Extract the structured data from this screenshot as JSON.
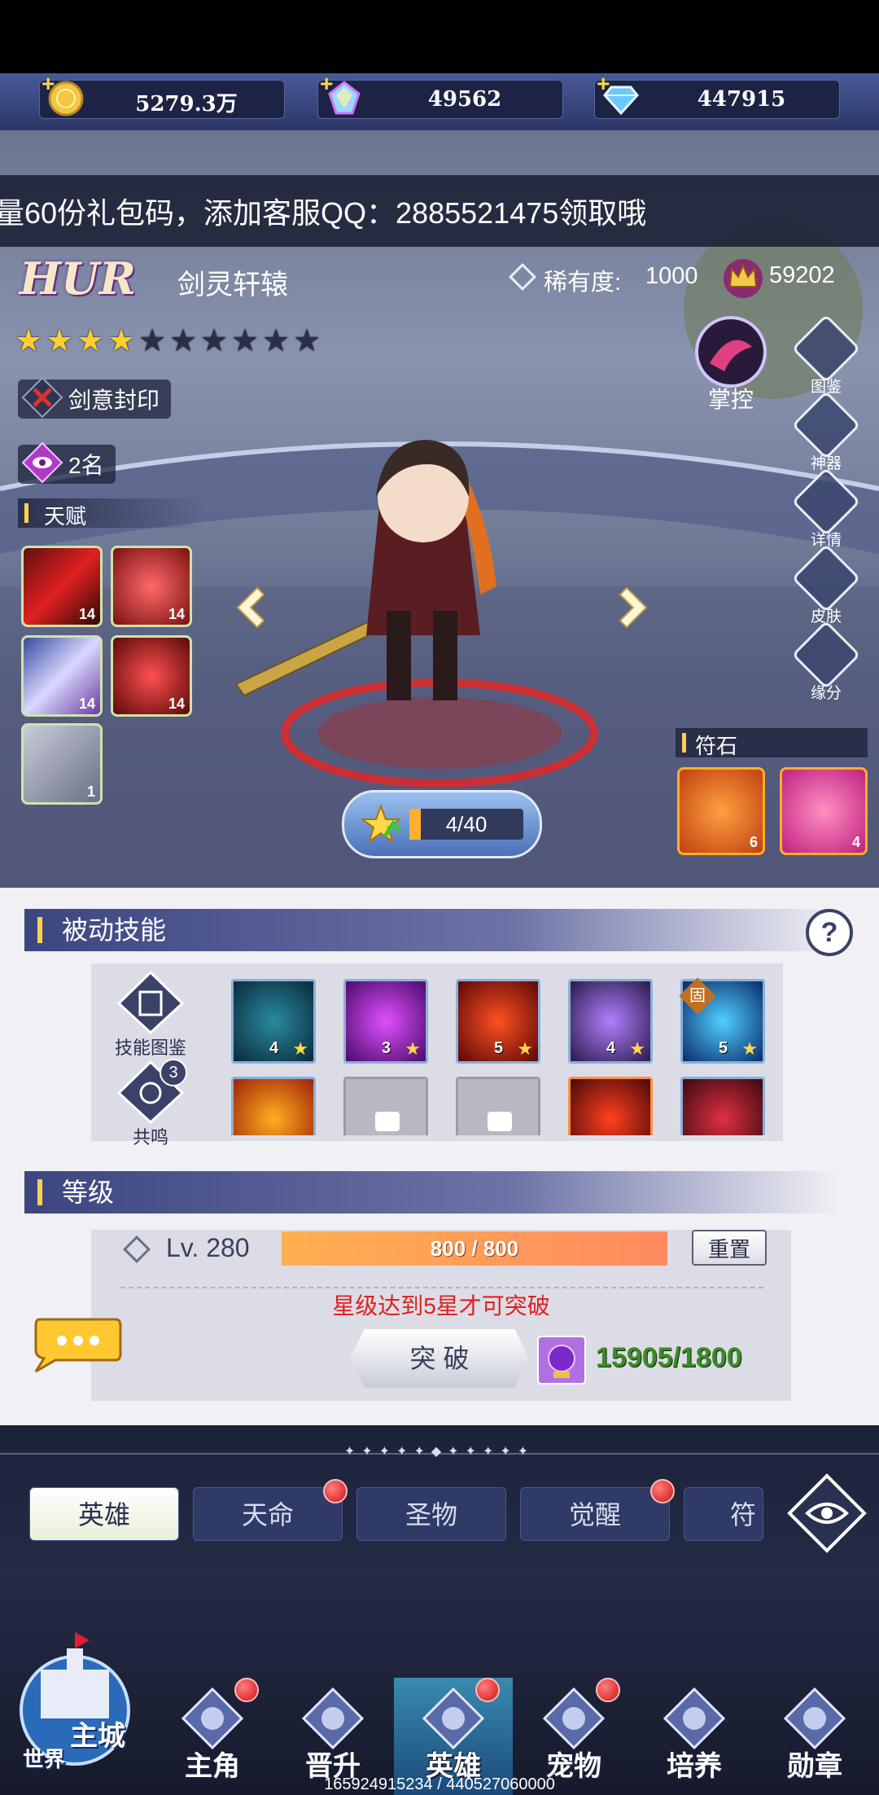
{
  "resources": {
    "gold": "5279.3万",
    "crystal": "49562",
    "diamond": "447915"
  },
  "marquee": "量60份礼包码，添加客服QQ：2885521475领取哦",
  "hero": {
    "grade": "HUR",
    "name": "剑灵轩辕",
    "rarity_label": "稀有度:",
    "rarity_value": "1000",
    "power": "59202",
    "stars_filled": 4,
    "stars_total": 10,
    "seal": "剑意封印",
    "rank": "2名",
    "talent_header": "天赋",
    "talent_levels": [
      "14",
      "14",
      "14",
      "14",
      "1"
    ],
    "control_label": "掌控",
    "progress": "4/40",
    "rune_header": "符石",
    "rune_levels": [
      "6",
      "4"
    ]
  },
  "side_buttons": [
    "图鉴",
    "神器",
    "详情",
    "皮肤",
    "缘分"
  ],
  "passive": {
    "title": "被动技能",
    "help": "?",
    "skill_book": "技能图鉴",
    "resonance": "共鸣",
    "resonance_badge": "3",
    "row1_levels": [
      "4",
      "3",
      "5",
      "4",
      "5"
    ],
    "fixed_tag": "固",
    "rune_tag": "符"
  },
  "level": {
    "title": "等级",
    "lv": "Lv. 280",
    "exp": "800 / 800",
    "exp_fraction": 1.0,
    "reset": "重置",
    "warning": "星级达到5星才可突破",
    "breakthrough": "突 破",
    "materials": "15905/1800"
  },
  "tabs": [
    "英雄",
    "天命",
    "圣物",
    "觉醒",
    "符文"
  ],
  "nav": {
    "main_city": "主城",
    "world": "世界",
    "items": [
      "主角",
      "晋升",
      "英雄",
      "宠物",
      "培养",
      "勋章"
    ]
  },
  "footer_text": "165924915234 / 440527060000",
  "colors": {
    "accent_gold": "#ffd050",
    "warning_red": "#e02020",
    "material_green": "#3c8a2a",
    "exp_bar": "#ff9a50"
  }
}
